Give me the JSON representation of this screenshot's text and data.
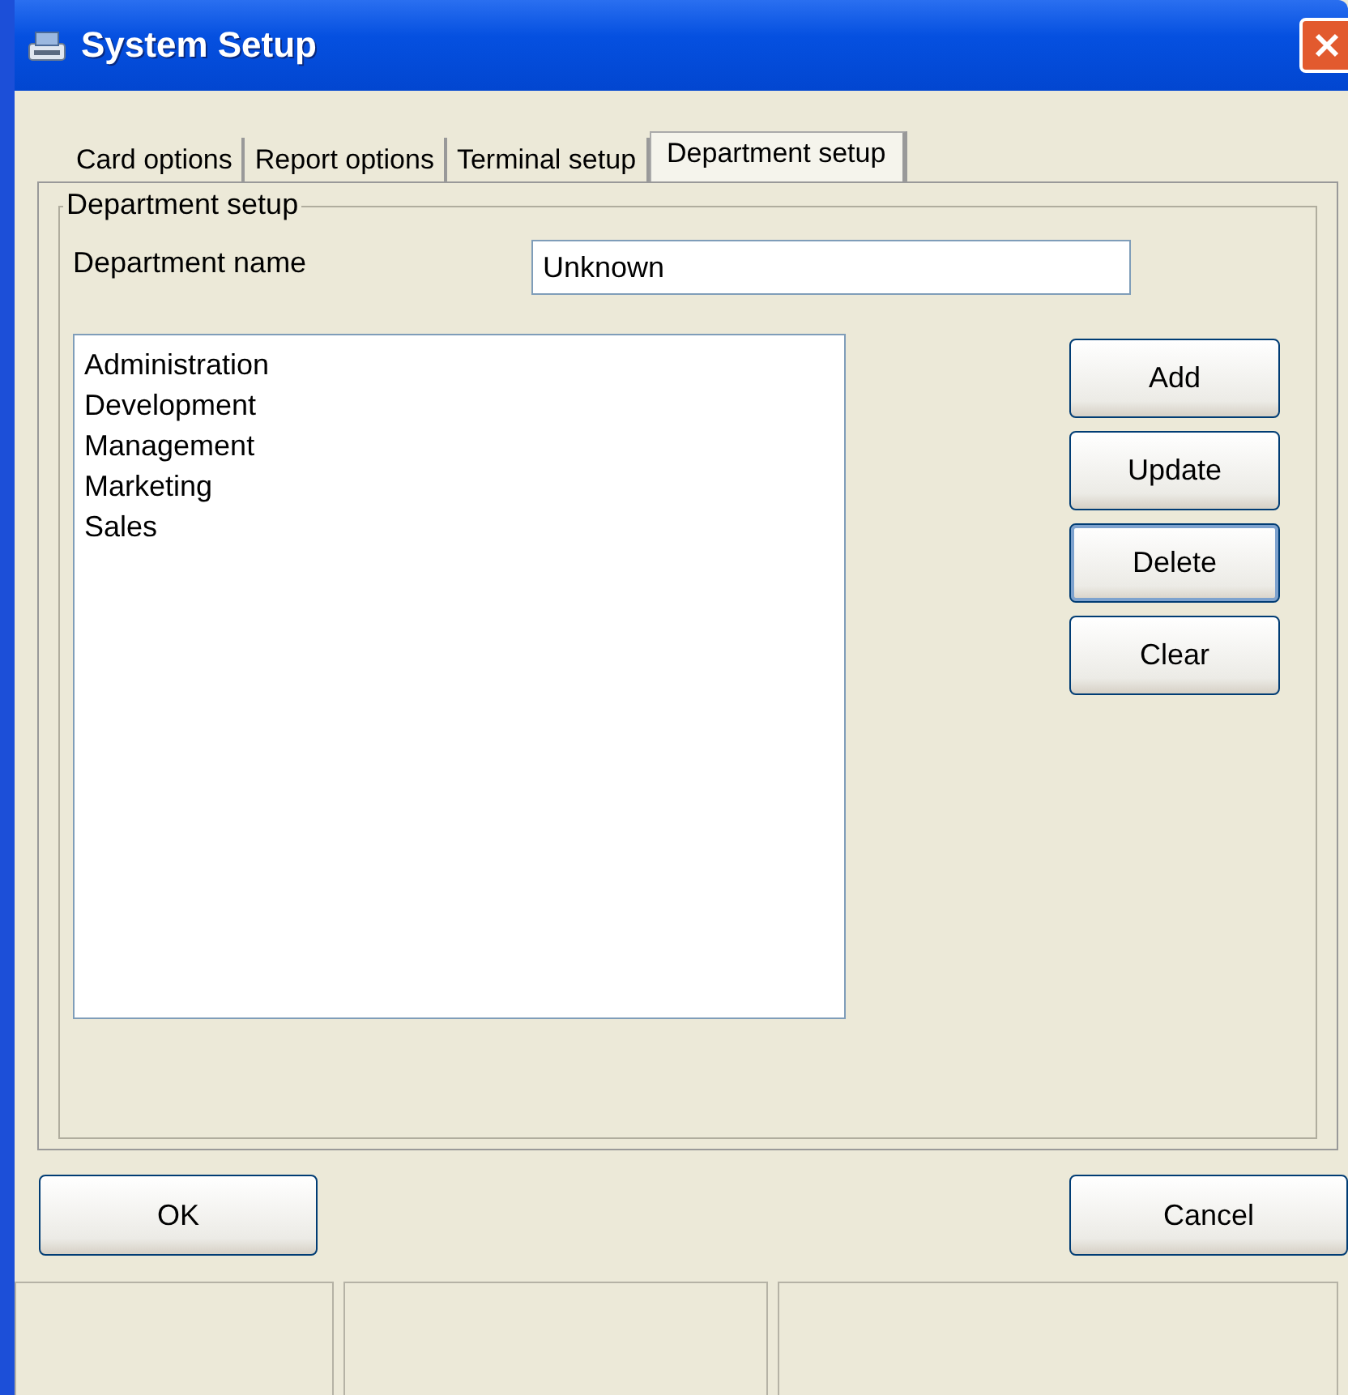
{
  "window": {
    "title": "System Setup"
  },
  "tabs": [
    {
      "label": "Card options",
      "selected": false
    },
    {
      "label": "Report options",
      "selected": false
    },
    {
      "label": "Terminal setup",
      "selected": false
    },
    {
      "label": "Department setup",
      "selected": true
    }
  ],
  "group": {
    "title": "Department setup"
  },
  "department_name": {
    "label": "Department name",
    "value": "Unknown"
  },
  "departments": [
    "Administration",
    "Development",
    "Management",
    "Marketing",
    "Sales"
  ],
  "side_buttons": [
    {
      "label": "Add",
      "focused": false
    },
    {
      "label": "Update",
      "focused": false
    },
    {
      "label": "Delete",
      "focused": true
    },
    {
      "label": "Clear",
      "focused": false
    }
  ],
  "ok_button": {
    "label": "OK"
  },
  "cancel_button": {
    "label": "Cancel"
  }
}
